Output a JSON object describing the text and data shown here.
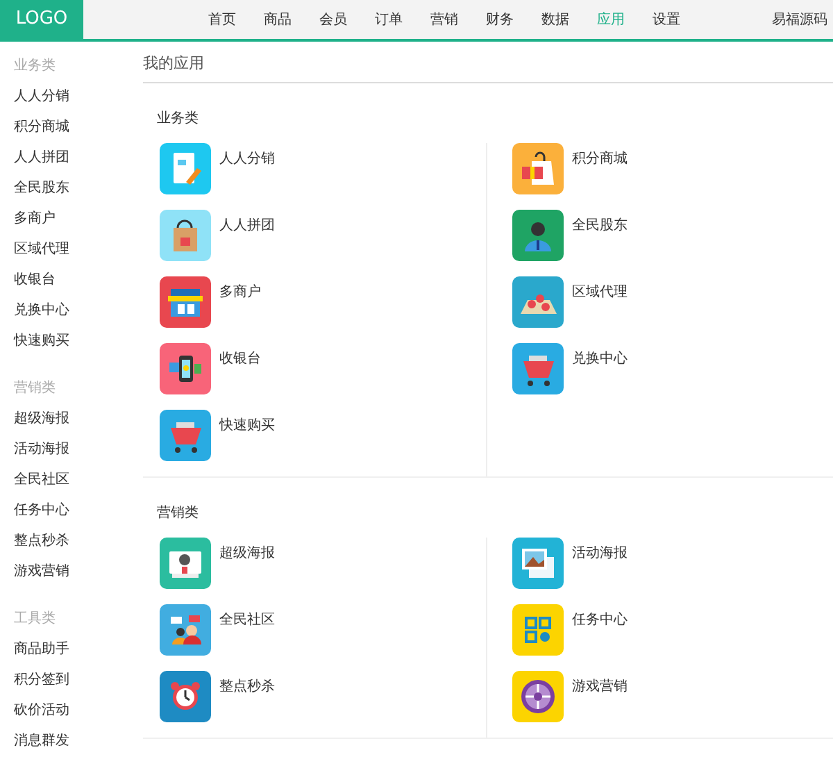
{
  "header": {
    "logo": "LOGO",
    "nav": [
      {
        "label": "首页",
        "selected": false
      },
      {
        "label": "商品",
        "selected": false
      },
      {
        "label": "会员",
        "selected": false
      },
      {
        "label": "订单",
        "selected": false
      },
      {
        "label": "营销",
        "selected": false
      },
      {
        "label": "财务",
        "selected": false
      },
      {
        "label": "数据",
        "selected": false
      },
      {
        "label": "应用",
        "selected": true
      },
      {
        "label": "设置",
        "selected": false
      }
    ],
    "user": "易福源码"
  },
  "sidebar": {
    "groups": [
      {
        "title": "业务类",
        "items": [
          "人人分销",
          "积分商城",
          "人人拼团",
          "全民股东",
          "多商户",
          "区域代理",
          "收银台",
          "兑换中心",
          "快速购买"
        ]
      },
      {
        "title": "营销类",
        "items": [
          "超级海报",
          "活动海报",
          "全民社区",
          "任务中心",
          "整点秒杀",
          "游戏营销"
        ]
      },
      {
        "title": "工具类",
        "items": [
          "商品助手",
          "积分签到",
          "砍价活动",
          "消息群发"
        ]
      }
    ]
  },
  "page_title": "我的应用",
  "sections": [
    {
      "title": "业务类",
      "columns": [
        [
          {
            "label": "人人分销",
            "color": "#1ec8f0"
          },
          {
            "label": "人人拼团",
            "color": "#8fe2f7"
          },
          {
            "label": "多商户",
            "color": "#e8474f"
          },
          {
            "label": "收银台",
            "color": "#f86479"
          },
          {
            "label": "快速购买",
            "color": "#29abe2"
          }
        ],
        [
          {
            "label": "积分商城",
            "color": "#fbb03b"
          },
          {
            "label": "全民股东",
            "color": "#1fa464"
          },
          {
            "label": "区域代理",
            "color": "#2aa8cc"
          },
          {
            "label": "兑换中心",
            "color": "#29abe2"
          }
        ]
      ]
    },
    {
      "title": "营销类",
      "columns": [
        [
          {
            "label": "超级海报",
            "color": "#2bbd9f"
          },
          {
            "label": "全民社区",
            "color": "#41ade0"
          },
          {
            "label": "整点秒杀",
            "color": "#1e8bc3"
          }
        ],
        [
          {
            "label": "活动海报",
            "color": "#22b3d6"
          },
          {
            "label": "任务中心",
            "color": "#fcd400"
          },
          {
            "label": "游戏营销",
            "color": "#fcd400"
          }
        ]
      ]
    }
  ]
}
